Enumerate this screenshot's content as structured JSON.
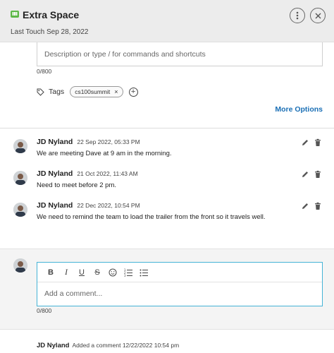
{
  "header": {
    "title": "Extra Space",
    "last_touch": "Last Touch Sep 28, 2022",
    "brand_color": "#5db848"
  },
  "description": {
    "placeholder": "Description or type / for commands and shortcuts",
    "counter": "0/800"
  },
  "tags": {
    "label": "Tags",
    "items": [
      "cs100summit"
    ]
  },
  "more_options": "More Options",
  "notes": [
    {
      "author": "JD Nyland",
      "date": "22 Sep 2022, 05:33 PM",
      "text": "We are meeting Dave at 9 am in the morning."
    },
    {
      "author": "JD Nyland",
      "date": "21 Oct 2022, 11:43 AM",
      "text": "Need to meet before 2 pm."
    },
    {
      "author": "JD Nyland",
      "date": "22 Dec 2022, 10:54 PM",
      "text": "We need to remind the team to load the trailer from the front so it travels well."
    }
  ],
  "comment": {
    "placeholder": "Add a comment...",
    "counter": "0/800",
    "toolbar": [
      "bold-icon",
      "italic-icon",
      "underline-icon",
      "strikethrough-icon",
      "emoji-icon",
      "numbered-list-icon",
      "bullet-list-icon"
    ]
  },
  "activity": {
    "author": "JD Nyland",
    "text": "Added a comment 12/22/2022 10:54 pm"
  }
}
